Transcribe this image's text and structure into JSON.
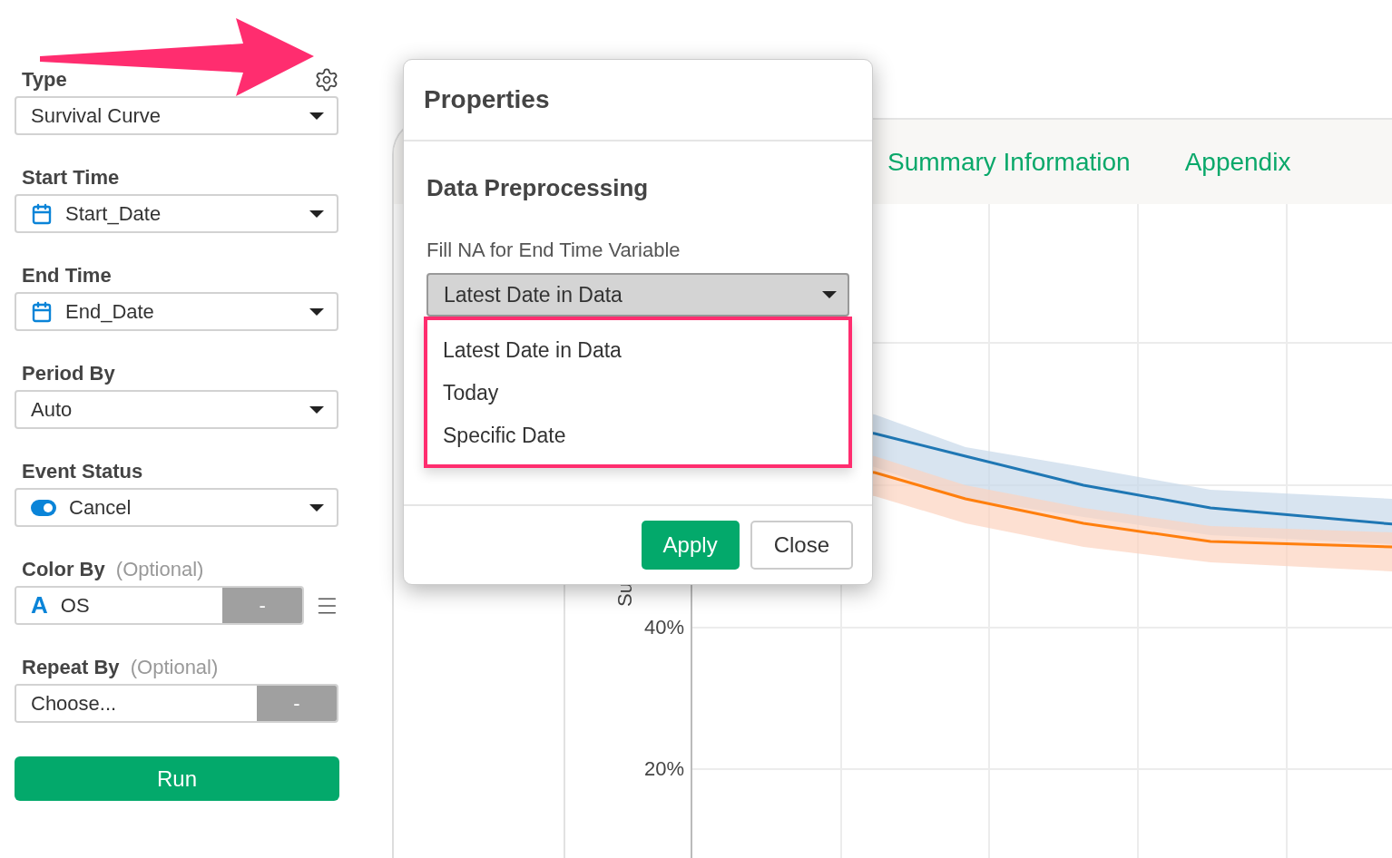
{
  "sidebar": {
    "fields": [
      {
        "label": "Type",
        "kind": "select",
        "value": "Survival Curve",
        "settings": true
      },
      {
        "label": "Start Time",
        "kind": "date",
        "value": "Start_Date"
      },
      {
        "label": "End Time",
        "kind": "date",
        "value": "End_Date"
      },
      {
        "label": "Period By",
        "kind": "select",
        "value": "Auto"
      },
      {
        "label": "Event Status",
        "kind": "status",
        "value": "Cancel"
      },
      {
        "label": "Color By",
        "hint": "(Optional)",
        "kind": "column",
        "icon_text": "A",
        "value": "OS",
        "button": "-",
        "reorder": true
      },
      {
        "label": "Repeat By",
        "hint": "(Optional)",
        "kind": "choice",
        "value": "Choose...",
        "button": "-"
      }
    ],
    "run_button": "Run"
  },
  "report": {
    "tabs": [
      "Summary Information",
      "Appendix"
    ],
    "chart": {
      "ylabel": "Su",
      "yticks": [
        "40%",
        "20%"
      ]
    }
  },
  "modal": {
    "title": "Properties",
    "section": "Data Preprocessing",
    "field_label": "Fill NA for End Time Variable",
    "select": {
      "value": "Latest Date in Data",
      "open": true,
      "options": [
        "Latest Date in Data",
        "Today",
        "Specific Date"
      ]
    },
    "buttons": [
      {
        "label": "Apply",
        "kind": "primary"
      },
      {
        "label": "Close",
        "kind": "default"
      }
    ]
  }
}
